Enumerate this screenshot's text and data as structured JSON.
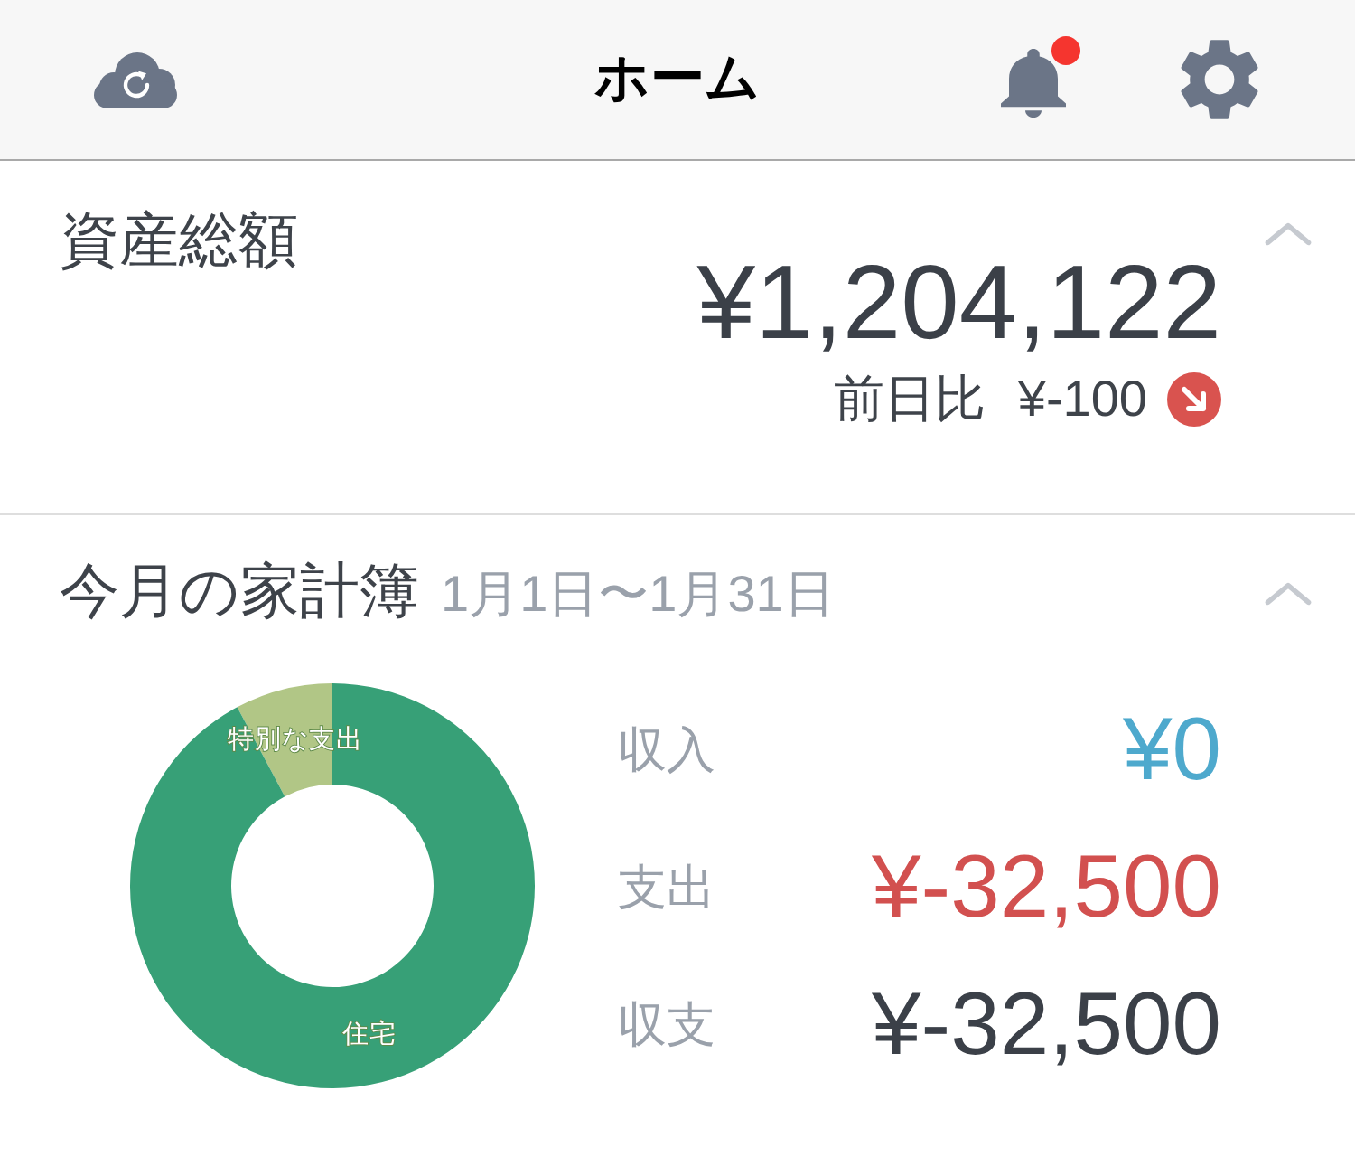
{
  "header": {
    "title": "ホーム",
    "bell": {
      "unread": true
    }
  },
  "assets": {
    "title": "資産総額",
    "expanded": true,
    "total": "¥1,204,122",
    "change_label": "前日比",
    "change": "¥-100",
    "decreased": true
  },
  "budget": {
    "title": "今月の家計簿",
    "period": "1月1日〜1月31日",
    "expanded": true,
    "slices": [
      {
        "label": "特別な支出",
        "color": "#b1c686"
      },
      {
        "label": "住宅",
        "color": "#37a077"
      }
    ],
    "rows": [
      {
        "label": "収入",
        "value": "¥0",
        "color": "#4ea9cd"
      },
      {
        "label": "支出",
        "value": "¥-32,500",
        "color": "#d2504f"
      },
      {
        "label": "収支",
        "value": "¥-32,500",
        "color": "#3b4048"
      }
    ]
  }
}
